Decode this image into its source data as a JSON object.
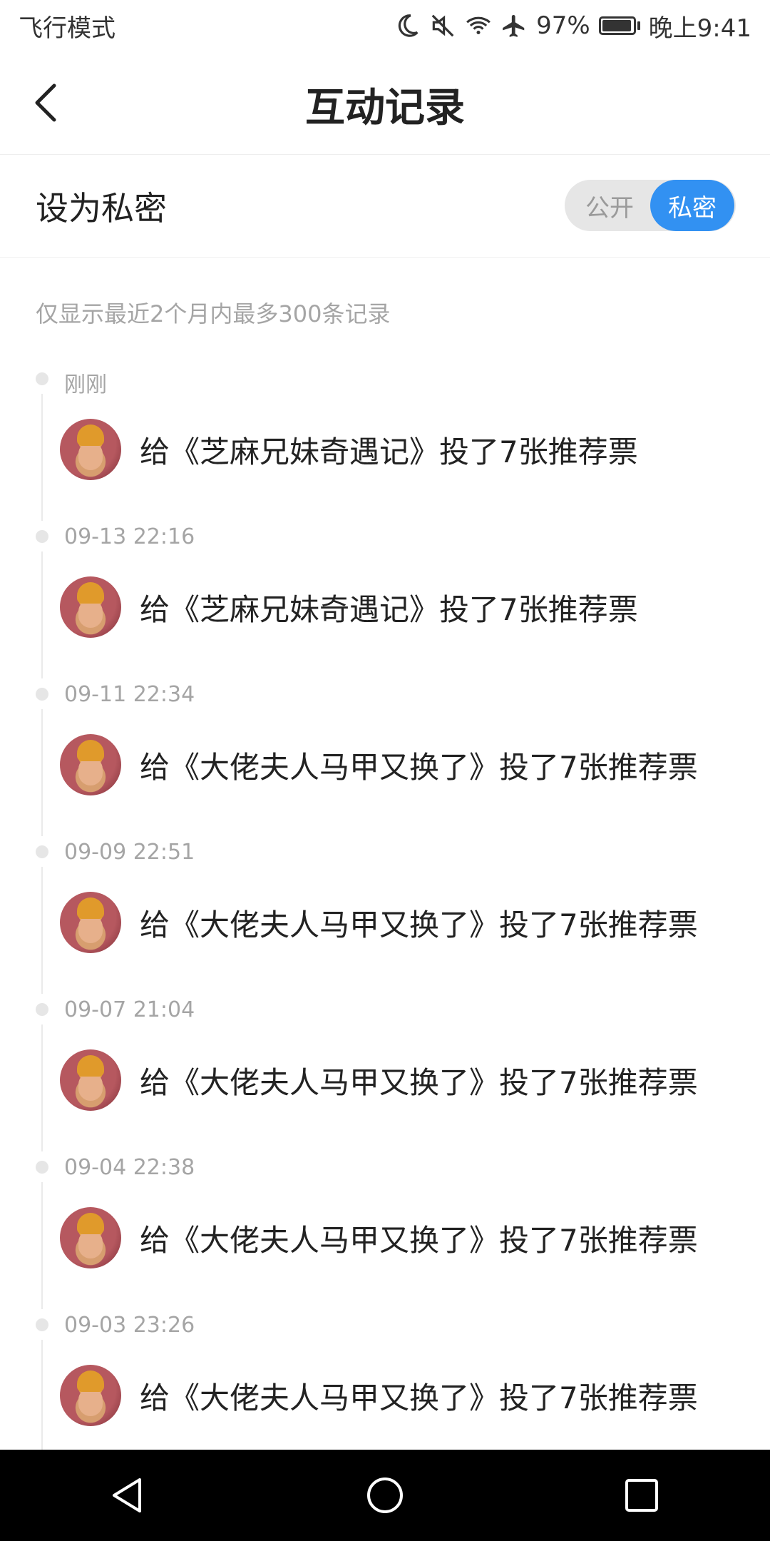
{
  "status_bar": {
    "left_text": "飞行模式",
    "battery_percent": "97%",
    "time": "晚上9:41",
    "icons": [
      "moon-icon",
      "mute-icon",
      "wifi-icon",
      "airplane-icon",
      "battery-icon"
    ]
  },
  "header": {
    "title": "互动记录",
    "back_icon": "back-arrow-icon"
  },
  "privacy": {
    "label": "设为私密",
    "toggle": {
      "public_label": "公开",
      "private_label": "私密",
      "selected": "私密",
      "accent_color": "#3291f2"
    }
  },
  "notice": "仅显示最近2个月内最多300条记录",
  "records": [
    {
      "time": "刚刚",
      "text": "给《芝麻兄妹奇遇记》投了7张推荐票"
    },
    {
      "time": "09-13 22:16",
      "text": "给《芝麻兄妹奇遇记》投了7张推荐票"
    },
    {
      "time": "09-11 22:34",
      "text": "给《大佬夫人马甲又换了》投了7张推荐票"
    },
    {
      "time": "09-09 22:51",
      "text": "给《大佬夫人马甲又换了》投了7张推荐票"
    },
    {
      "time": "09-07 21:04",
      "text": "给《大佬夫人马甲又换了》投了7张推荐票"
    },
    {
      "time": "09-04 22:38",
      "text": "给《大佬夫人马甲又换了》投了7张推荐票"
    },
    {
      "time": "09-03 23:26",
      "text": "给《大佬夫人马甲又换了》投了7张推荐票"
    }
  ],
  "nav": {
    "icons": [
      "nav-back-icon",
      "nav-home-icon",
      "nav-recents-icon"
    ]
  }
}
